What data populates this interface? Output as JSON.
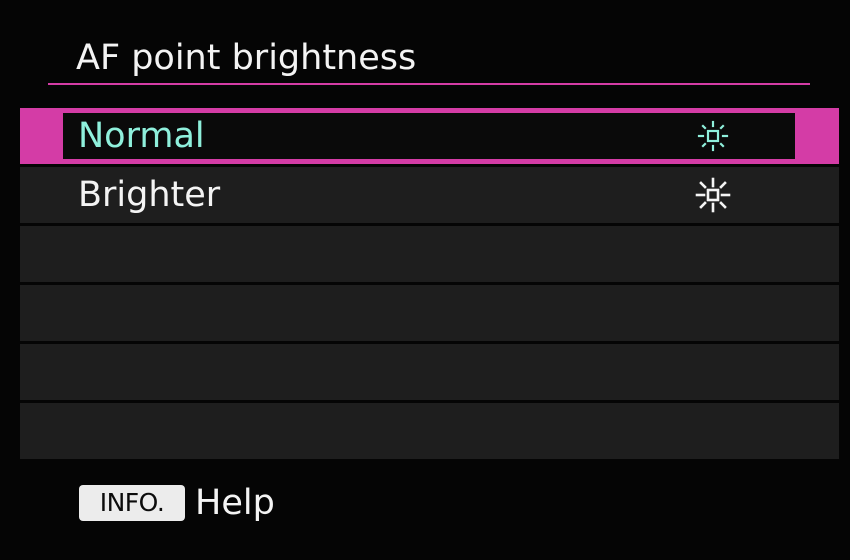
{
  "title": "AF point brightness",
  "options": [
    {
      "label": "Normal",
      "icon": "af-point-normal-icon",
      "selected": true
    },
    {
      "label": "Brighter",
      "icon": "af-point-brighter-icon",
      "selected": false
    }
  ],
  "empty_rows": 4,
  "footer": {
    "button_label": "INFO.",
    "action_label": "Help"
  },
  "colors": {
    "accent": "#d43ca6",
    "selected_text": "#8ff0dc",
    "text": "#f4f4f4",
    "row_background": "#1e1e1e",
    "background": "#050505"
  }
}
